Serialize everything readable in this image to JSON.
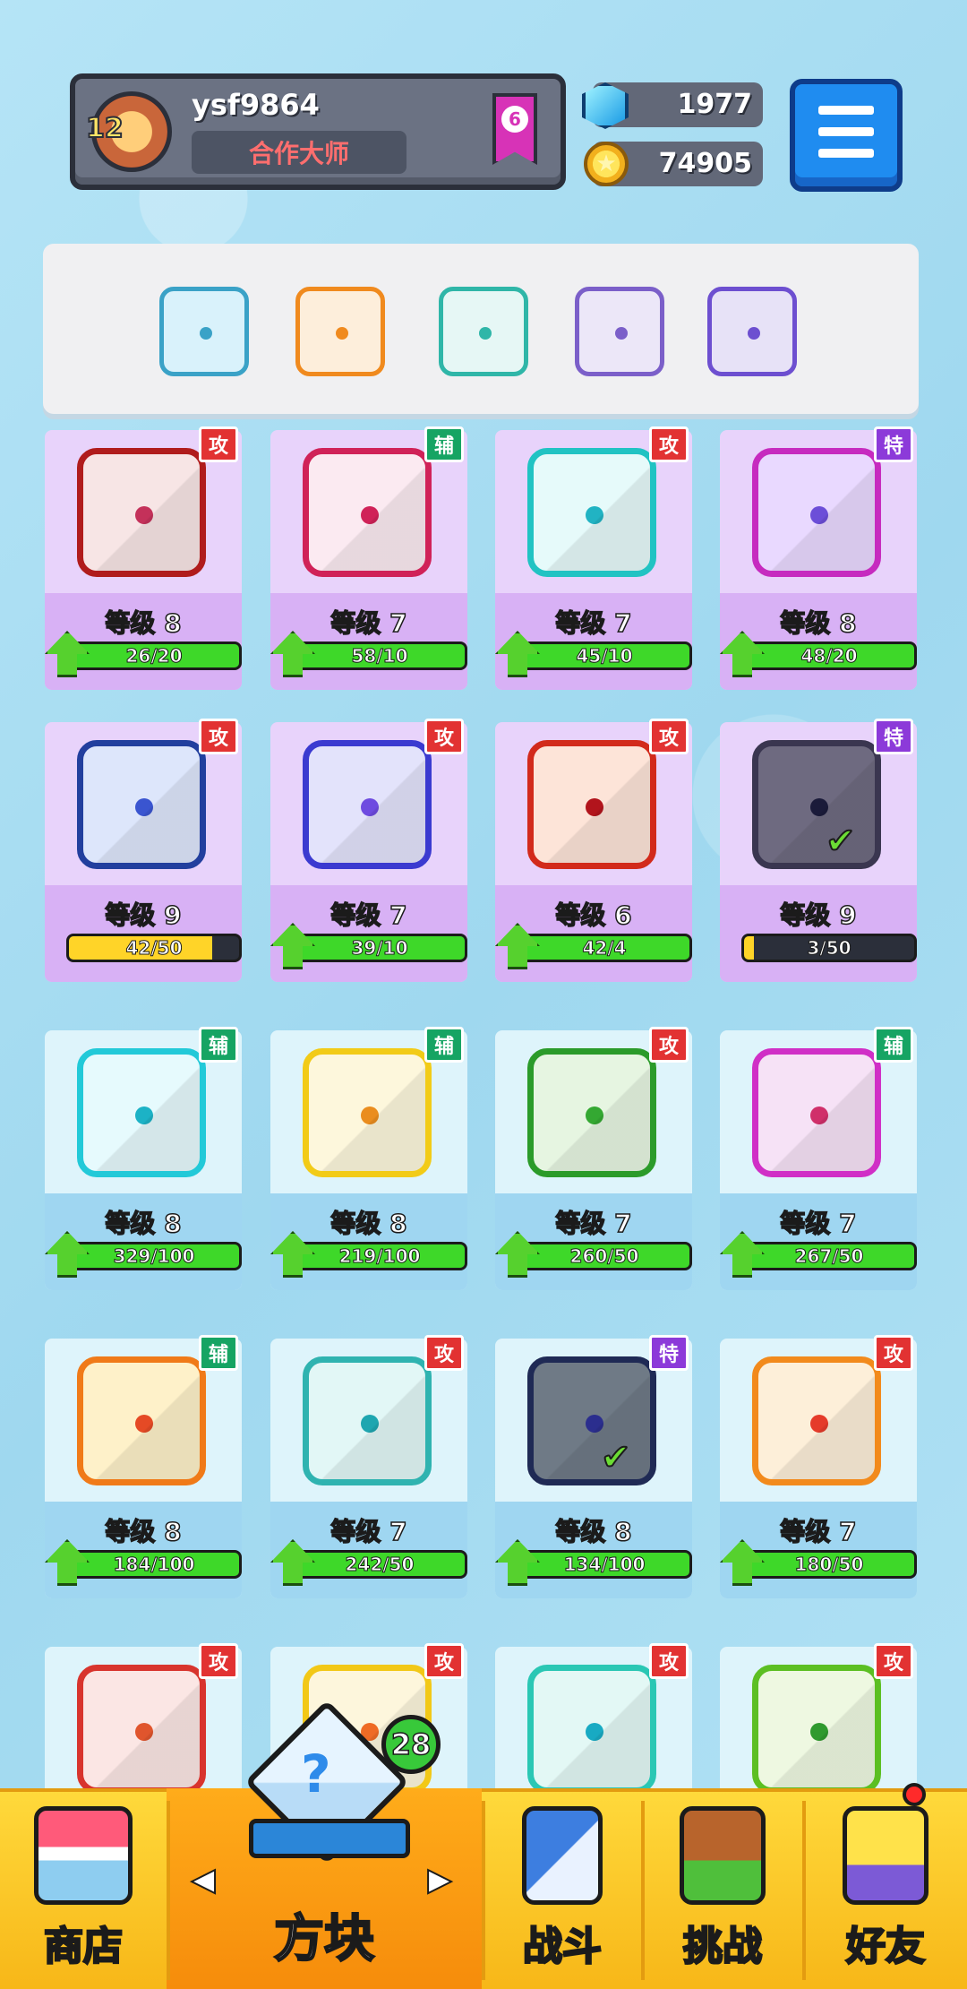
{
  "header": {
    "avatar_level": "12",
    "username": "ysf9864",
    "title": "合作大师",
    "rank": "6",
    "gems": "1977",
    "coins": "74905"
  },
  "deck": [
    {
      "name": "vortex-dragon",
      "color": "#3aa2c7",
      "bg": "#d9f2fb"
    },
    {
      "name": "fire-dragon",
      "color": "#f08a1e",
      "bg": "#fdeedb"
    },
    {
      "name": "hands-light",
      "color": "#2fb6a8",
      "bg": "#e6f7f5"
    },
    {
      "name": "purple-crack",
      "color": "#7b5fc9",
      "bg": "#ece7f8"
    },
    {
      "name": "purple-dragon",
      "color": "#6d4fd0",
      "bg": "#e7e2f7"
    }
  ],
  "cards": [
    {
      "tag": "攻",
      "tag_color": "#e23232",
      "level": "等级 8",
      "progress": "26/20",
      "upgradable": true,
      "fill": 1.0,
      "frame": "#b01c1c",
      "face": "#f7e5e5",
      "dot": "#c4315a",
      "bottom": "#d8b1f5",
      "top": "#e8d3fb"
    },
    {
      "tag": "辅",
      "tag_color": "#16a463",
      "level": "等级 7",
      "progress": "58/10",
      "upgradable": true,
      "fill": 1.0,
      "frame": "#d02258",
      "face": "#fbeaf1",
      "dot": "#d02258",
      "bottom": "#d8b1f5",
      "top": "#e8d3fb"
    },
    {
      "tag": "攻",
      "tag_color": "#e23232",
      "level": "等级 7",
      "progress": "45/10",
      "upgradable": true,
      "fill": 1.0,
      "frame": "#21c3c3",
      "face": "#e6fafa",
      "dot": "#21b3c3",
      "bottom": "#d8b1f5",
      "top": "#e8d3fb"
    },
    {
      "tag": "特",
      "tag_color": "#8c3ad9",
      "level": "等级 8",
      "progress": "48/20",
      "upgradable": true,
      "fill": 1.0,
      "frame": "#c62bbf",
      "face": "#e9d9ff",
      "dot": "#6c4ed8",
      "bottom": "#d8b1f5",
      "top": "#e8d3fb"
    },
    {
      "tag": "攻",
      "tag_color": "#e23232",
      "level": "等级 9",
      "progress": "42/50",
      "upgradable": false,
      "fill": 0.84,
      "fill_color": "#ffd428",
      "frame": "#223f9e",
      "face": "#dde6fb",
      "dot": "#3a55d0",
      "bottom": "#d8b1f5",
      "top": "#e8d3fb"
    },
    {
      "tag": "攻",
      "tag_color": "#e23232",
      "level": "等级 7",
      "progress": "39/10",
      "upgradable": true,
      "fill": 1.0,
      "frame": "#3b3ad0",
      "face": "#e3e3fb",
      "dot": "#6e4be0",
      "bottom": "#d8b1f5",
      "top": "#e8d3fb"
    },
    {
      "tag": "攻",
      "tag_color": "#e23232",
      "level": "等级 6",
      "progress": "42/4",
      "upgradable": true,
      "fill": 1.0,
      "frame": "#d22a1b",
      "face": "#fde4d8",
      "dot": "#b2141c",
      "bottom": "#d8b1f5",
      "top": "#e8d3fb"
    },
    {
      "tag": "特",
      "tag_color": "#8c3ad9",
      "level": "等级 9",
      "progress": "3/50",
      "upgradable": false,
      "fill": 0.06,
      "fill_color": "#ffd428",
      "frame": "#3a3650",
      "face": "#6e6a80",
      "dot": "#1b1b3a",
      "check": true,
      "bottom": "#d8b1f5",
      "top": "#e8d3fb"
    },
    {
      "tag": "辅",
      "tag_color": "#16a463",
      "level": "等级 8",
      "progress": "329/100",
      "upgradable": true,
      "fill": 1.0,
      "frame": "#22c9d8",
      "face": "#e6fafd",
      "dot": "#1cb2c6",
      "bottom": "#9fd6f1",
      "top": "#def4fb"
    },
    {
      "tag": "辅",
      "tag_color": "#16a463",
      "level": "等级 8",
      "progress": "219/100",
      "upgradable": true,
      "fill": 1.0,
      "frame": "#f2cb17",
      "face": "#fdf7dc",
      "dot": "#ea8d1e",
      "bottom": "#9fd6f1",
      "top": "#def4fb"
    },
    {
      "tag": "攻",
      "tag_color": "#e23232",
      "level": "等级 7",
      "progress": "260/50",
      "upgradable": true,
      "fill": 1.0,
      "frame": "#2b9b2a",
      "face": "#e6f5e1",
      "dot": "#34a832",
      "bottom": "#9fd6f1",
      "top": "#def4fb"
    },
    {
      "tag": "辅",
      "tag_color": "#16a463",
      "level": "等级 7",
      "progress": "267/50",
      "upgradable": true,
      "fill": 1.0,
      "frame": "#d02fc6",
      "face": "#f6e2f6",
      "dot": "#d02f6a",
      "bottom": "#9fd6f1",
      "top": "#def4fb"
    },
    {
      "tag": "辅",
      "tag_color": "#16a463",
      "level": "等级 8",
      "progress": "184/100",
      "upgradable": true,
      "fill": 1.0,
      "frame": "#f07a18",
      "face": "#fef1c9",
      "dot": "#e54a25",
      "bottom": "#9fd6f1",
      "top": "#def4fb"
    },
    {
      "tag": "攻",
      "tag_color": "#e23232",
      "level": "等级 7",
      "progress": "242/50",
      "upgradable": true,
      "fill": 1.0,
      "frame": "#2fb3b0",
      "face": "#e2f7f6",
      "dot": "#1ea6b0",
      "bottom": "#9fd6f1",
      "top": "#def4fb"
    },
    {
      "tag": "特",
      "tag_color": "#8c3ad9",
      "level": "等级 8",
      "progress": "134/100",
      "upgradable": true,
      "fill": 1.0,
      "frame": "#1f2a55",
      "face": "#6f7a86",
      "dot": "#2b2e8e",
      "check": true,
      "bottom": "#9fd6f1",
      "top": "#def4fb"
    },
    {
      "tag": "攻",
      "tag_color": "#e23232",
      "level": "等级 7",
      "progress": "180/50",
      "upgradable": true,
      "fill": 1.0,
      "frame": "#f28a1c",
      "face": "#fdefd9",
      "dot": "#e53b2a",
      "bottom": "#9fd6f1",
      "top": "#def4fb"
    },
    {
      "tag": "攻",
      "tag_color": "#e23232",
      "level": "",
      "progress": "",
      "upgradable": false,
      "fill": 0,
      "frame": "#d8342d",
      "face": "#fbe6e4",
      "dot": "#e0552d",
      "bottom": "#9fd6f1",
      "top": "#def4fb"
    },
    {
      "tag": "攻",
      "tag_color": "#e23232",
      "level": "",
      "progress": "",
      "upgradable": false,
      "fill": 0,
      "frame": "#f2c817",
      "face": "#fdf6dc",
      "dot": "#ef6b25",
      "bottom": "#9fd6f1",
      "top": "#def4fb"
    },
    {
      "tag": "攻",
      "tag_color": "#e23232",
      "level": "",
      "progress": "",
      "upgradable": false,
      "fill": 0,
      "frame": "#2ac7b4",
      "face": "#e3f8f5",
      "dot": "#18aac3",
      "bottom": "#9fd6f1",
      "top": "#def4fb"
    },
    {
      "tag": "攻",
      "tag_color": "#e23232",
      "level": "",
      "progress": "",
      "upgradable": false,
      "fill": 0,
      "frame": "#5cbf22",
      "face": "#eef8e1",
      "dot": "#2f9a2e",
      "bottom": "#9fd6f1",
      "top": "#def4fb"
    }
  ],
  "nav": {
    "shop": "商店",
    "cubes": "方块",
    "cubes_badge": "28",
    "battle": "战斗",
    "challenge": "挑战",
    "friends": "好友",
    "prev_arrow": "◀",
    "next_arrow": "▶"
  }
}
